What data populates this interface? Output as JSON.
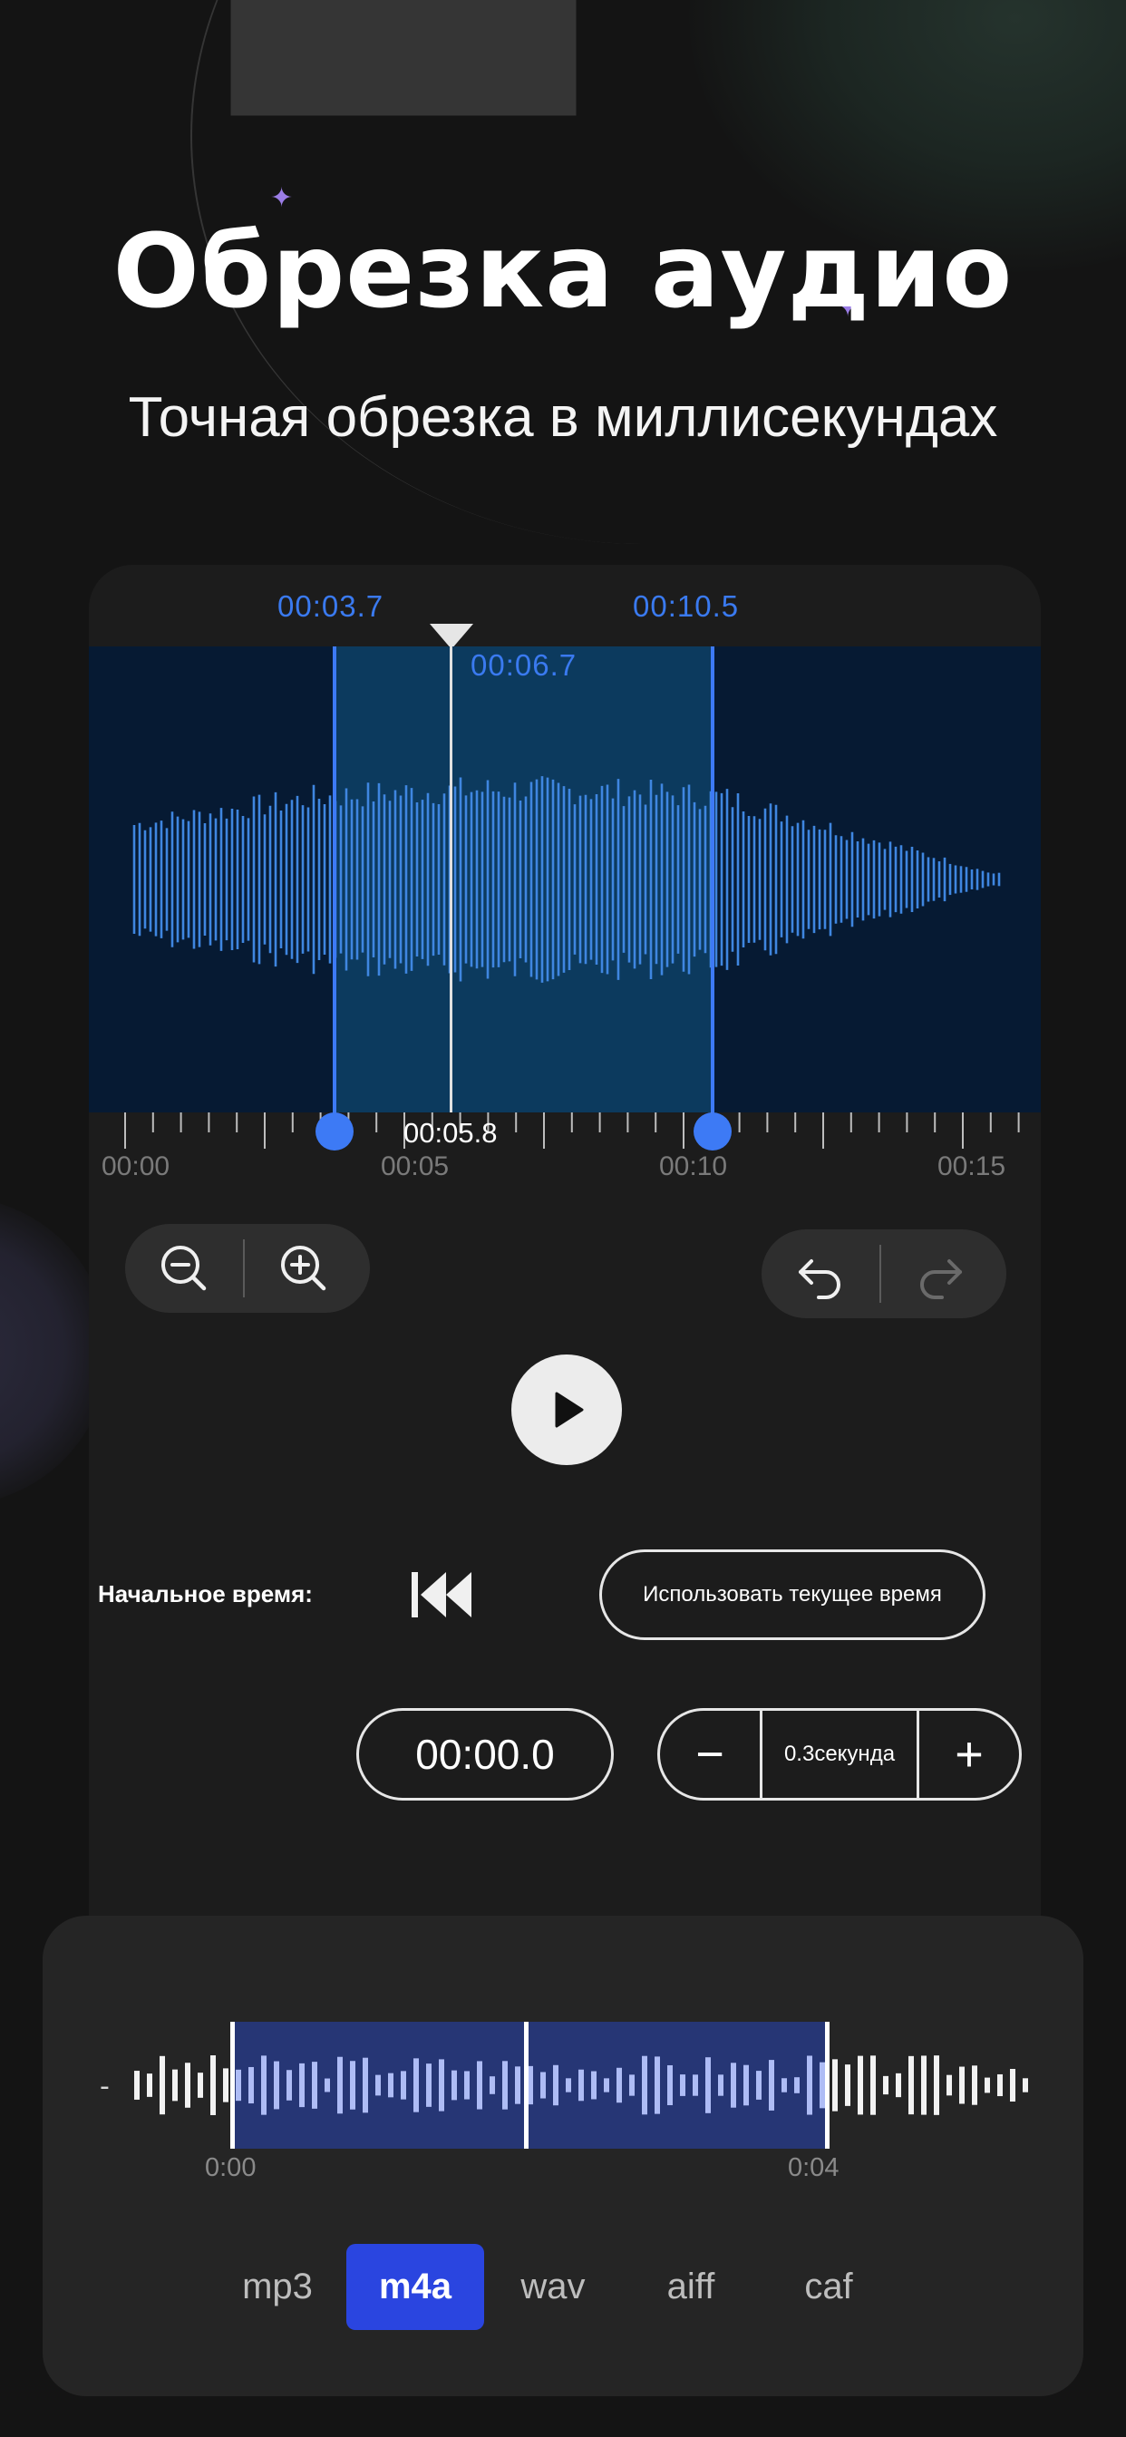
{
  "hero": {
    "title": "Обрезка аудио",
    "subtitle": "Точная обрезка в миллисекундах"
  },
  "editor": {
    "selection_start": "00:03.7",
    "selection_end": "00:10.5",
    "playhead_time": "00:06.7",
    "cursor_time": "00:05.8",
    "ruler_labels": [
      "00:00",
      "00:05",
      "00:10",
      "00:15"
    ],
    "zoom_out_icon": "zoom-out-icon",
    "zoom_in_icon": "zoom-in-icon",
    "undo_icon": "undo-icon",
    "redo_icon": "redo-icon",
    "play_icon": "play-icon",
    "start_time_label": "Начальное время:",
    "skip_back_icon": "skip-to-start-icon",
    "use_current_time": "Использовать текущее время",
    "time_value": "00:00.0",
    "step_minus": "−",
    "step_value": "0.3секунда",
    "step_plus": "+"
  },
  "preview": {
    "dash": "-",
    "start_label": "0:00",
    "end_label": "0:04"
  },
  "formats": {
    "items": [
      "mp3",
      "m4a",
      "wav",
      "aiff",
      "caf"
    ],
    "selected": "m4a"
  },
  "colors": {
    "accent": "#3d7af5",
    "format_active": "#2a45e0",
    "wave_bg": "#061a33",
    "wave_selected_bg": "#0c3a5e",
    "wave_bar": "#3f86e0"
  }
}
